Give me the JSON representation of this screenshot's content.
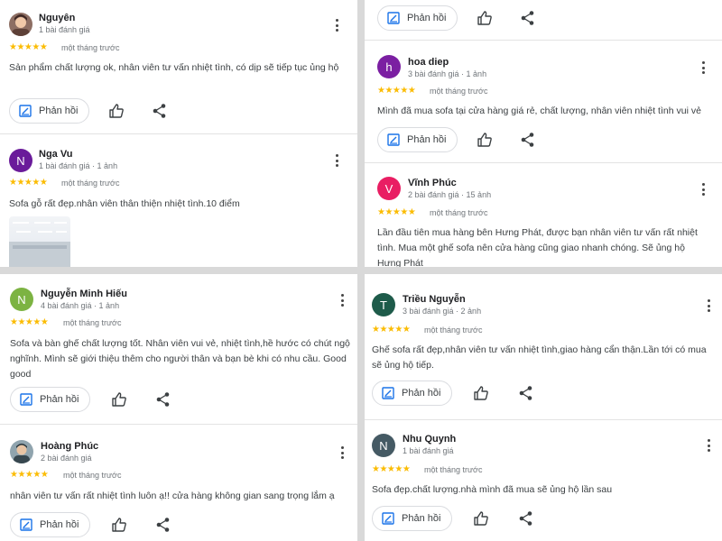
{
  "labels": {
    "reply": "Phản hồi"
  },
  "colors": {
    "star": "#fbbc04",
    "accent": "#1a73e8"
  },
  "panels": {
    "top_left": [
      {
        "name": "Nguyên",
        "meta": "1 bài đánh giá",
        "rating": 5,
        "stars": "★★★★★",
        "time": "một tháng trước",
        "text": "Sản phẩm chất lượng ok, nhân viên tư vấn nhiệt tình, có dịp sẽ tiếp tục ủng hộ"
      },
      {
        "initial": "N",
        "avatar_color": "#6a1b9a",
        "name": "Nga Vu",
        "meta": "1 bài đánh giá · 1 ảnh",
        "rating": 5,
        "stars": "★★★★★",
        "time": "một tháng trước",
        "text": "Sofa gỗ rất đẹp.nhân viên thân thiện nhiệt tình.10 điểm"
      }
    ],
    "top_right": [
      {
        "initial": "h",
        "avatar_color": "#7b1fa2",
        "name": "hoa diep",
        "meta": "3 bài đánh giá · 1 ảnh",
        "rating": 5,
        "stars": "★★★★★",
        "time": "một tháng trước",
        "text": "Mình đã mua sofa tại cửa hàng giá rẻ, chất lượng, nhân viên nhiệt tình vui vẻ"
      },
      {
        "initial": "V",
        "avatar_color": "#e91e63",
        "name": "Vĩnh Phúc",
        "meta": "2 bài đánh giá · 15 ảnh",
        "rating": 5,
        "stars": "★★★★★",
        "time": "một tháng trước",
        "text": "Lần đầu tiên mua hàng bên Hưng Phát, được bạn nhân viên tư vấn rất nhiệt tình. Mua một ghế sofa nên cửa hàng cũng giao nhanh chóng. Sẽ ủng hộ Hưng Phát"
      }
    ],
    "bottom_left": [
      {
        "initial": "N",
        "avatar_color": "#7cb342",
        "name": "Nguyễn Minh Hiếu",
        "meta": "4 bài đánh giá · 1 ảnh",
        "rating": 5,
        "stars": "★★★★★",
        "time": "một tháng trước",
        "text": "Sofa và bàn ghế chất lượng tốt. Nhân viên vui vẻ, nhiệt tình,hề hước có chút ngộ nghĩnh. Mình sẽ giới thiệu thêm cho người thân và bạn bè khi có nhu cầu. Good good"
      },
      {
        "name": "Hoàng Phúc",
        "meta": "2 bài đánh giá",
        "rating": 5,
        "stars": "★★★★★",
        "time": "một tháng trước",
        "text": "nhân viên tư vấn rất nhiệt tình luôn ạ!! cửa hàng không gian sang trọng lắm ạ"
      }
    ],
    "bottom_right": [
      {
        "initial": "T",
        "avatar_color": "#1e5b4a",
        "name": "Triều Nguyễn",
        "meta": "3 bài đánh giá · 2 ảnh",
        "rating": 5,
        "stars": "★★★★★",
        "time": "một tháng trước",
        "text": "Ghế sofa rất đẹp,nhân viên tư vấn nhiệt tình,giao hàng cẩn thận.Lần tới có mua sẽ ủng hộ tiếp."
      },
      {
        "initial": "N",
        "avatar_color": "#455a64",
        "name": "Nhu Quynh",
        "meta": "1 bài đánh giá",
        "rating": 5,
        "stars": "★★★★★",
        "time": "một tháng trước",
        "text": "Sofa đẹp.chất lượng.nhà mình đã mua sẽ ủng hộ lần sau"
      }
    ]
  }
}
